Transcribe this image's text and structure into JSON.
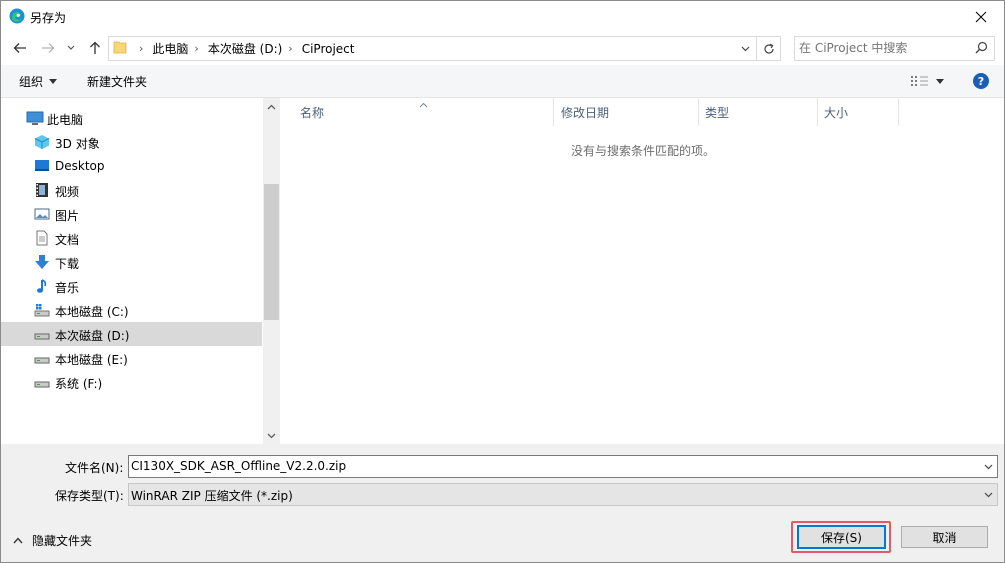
{
  "window": {
    "title": "另存为"
  },
  "address": {
    "crumbs": [
      "此电脑",
      "本次磁盘 (D:)",
      "CiProject"
    ]
  },
  "search": {
    "placeholder": "在 CiProject 中搜索"
  },
  "toolbar": {
    "organize": "组织",
    "new_folder": "新建文件夹",
    "help": "?"
  },
  "nav": {
    "items": [
      {
        "label": "此电脑",
        "icon": "computer-icon"
      },
      {
        "label": "3D 对象",
        "icon": "3d-objects-icon"
      },
      {
        "label": "Desktop",
        "icon": "desktop-icon"
      },
      {
        "label": "视频",
        "icon": "video-icon"
      },
      {
        "label": "图片",
        "icon": "pictures-icon"
      },
      {
        "label": "文档",
        "icon": "documents-icon"
      },
      {
        "label": "下载",
        "icon": "download-icon"
      },
      {
        "label": "音乐",
        "icon": "music-icon"
      },
      {
        "label": "本地磁盘 (C:)",
        "icon": "system-drive-icon"
      },
      {
        "label": "本次磁盘 (D:)",
        "icon": "drive-icon",
        "selected": true
      },
      {
        "label": "本地磁盘 (E:)",
        "icon": "drive-icon"
      },
      {
        "label": "系统 (F:)",
        "icon": "drive-icon"
      }
    ]
  },
  "list": {
    "columns": [
      "名称",
      "修改日期",
      "类型",
      "大小"
    ],
    "empty_message": "没有与搜索条件匹配的项。"
  },
  "form": {
    "filename_label": "文件名(N):",
    "filename_value": "CI130X_SDK_ASR_Offline_V2.2.0.zip",
    "filetype_label": "保存类型(T):",
    "filetype_value": "WinRAR ZIP 压缩文件 (*.zip)"
  },
  "footer": {
    "hide_folders": "隐藏文件夹",
    "save": "保存(S)",
    "cancel": "取消"
  },
  "colors": {
    "accent": "#0078d7",
    "highlight": "#e05a6a",
    "selected_bg": "#d9d9d9"
  }
}
